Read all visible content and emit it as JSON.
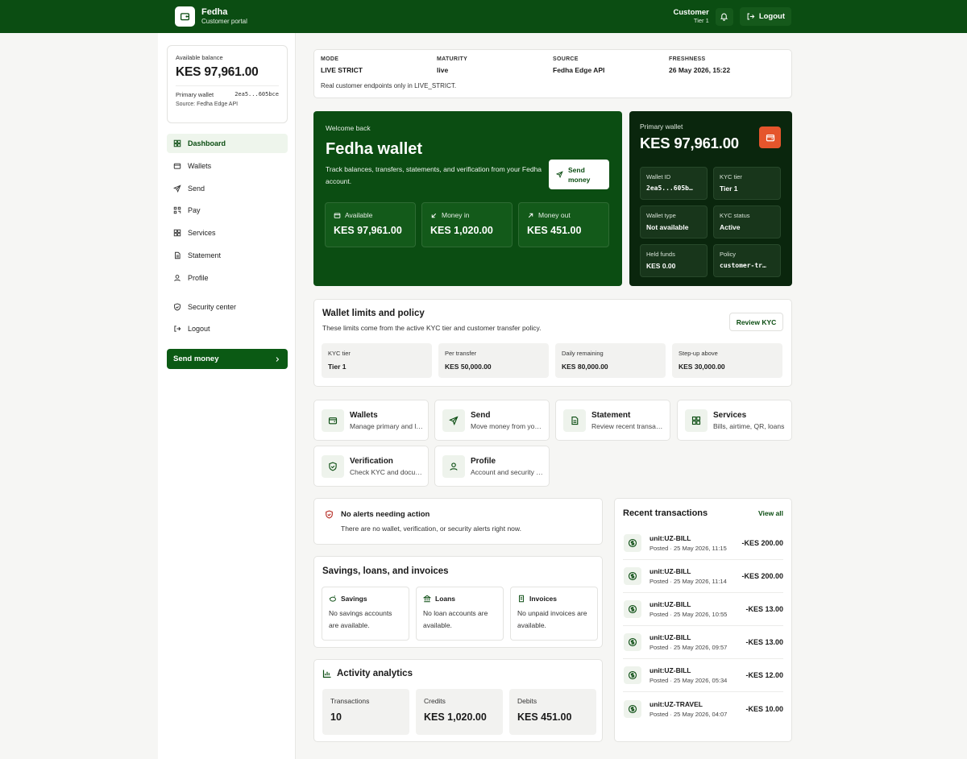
{
  "brand": {
    "title": "Fedha",
    "subtitle": "Customer portal"
  },
  "user": {
    "name": "Customer",
    "tier": "Tier 1"
  },
  "topbar": {
    "logout_label": "Logout"
  },
  "sidebar": {
    "balance_label": "Available balance",
    "balance_amount": "KES 97,961.00",
    "wallet_label": "Primary wallet",
    "wallet_id": "2ea5...605bce",
    "source": "Source: Fedha Edge API",
    "items": [
      {
        "label": "Dashboard",
        "icon": "dashboard-icon"
      },
      {
        "label": "Wallets",
        "icon": "wallet-icon"
      },
      {
        "label": "Send",
        "icon": "send-icon"
      },
      {
        "label": "Pay",
        "icon": "qr-icon"
      },
      {
        "label": "Services",
        "icon": "grid-icon"
      },
      {
        "label": "Statement",
        "icon": "document-icon"
      },
      {
        "label": "Profile",
        "icon": "user-icon"
      }
    ],
    "secondary": [
      {
        "label": "Security center",
        "icon": "shield-icon"
      },
      {
        "label": "Logout",
        "icon": "logout-icon"
      }
    ],
    "send_money_label": "Send money"
  },
  "mode": {
    "columns": [
      {
        "label": "MODE",
        "value": "LIVE STRICT"
      },
      {
        "label": "MATURITY",
        "value": "live"
      },
      {
        "label": "SOURCE",
        "value": "Fedha Edge API"
      },
      {
        "label": "FRESHNESS",
        "value": "26 May 2026, 15:22"
      }
    ],
    "note": "Real customer endpoints only in LIVE_STRICT."
  },
  "welcome": {
    "small": "Welcome back",
    "title": "Fedha wallet",
    "description": "Track balances, transfers, statements, and verification from your Fedha account.",
    "send_label_1": "Send",
    "send_label_2": "money",
    "stats": [
      {
        "label": "Available",
        "value": "KES 97,961.00"
      },
      {
        "label": "Money in",
        "value": "KES 1,020.00"
      },
      {
        "label": "Money out",
        "value": "KES 451.00"
      }
    ]
  },
  "primary_wallet": {
    "label": "Primary wallet",
    "amount": "KES 97,961.00",
    "cells": [
      {
        "label": "Wallet ID",
        "value": "2ea5...605b…",
        "mono": true
      },
      {
        "label": "KYC tier",
        "value": "Tier 1",
        "mono": false
      },
      {
        "label": "Wallet type",
        "value": "Not available",
        "mono": false
      },
      {
        "label": "KYC status",
        "value": "Active",
        "mono": false
      },
      {
        "label": "Held funds",
        "value": "KES 0.00",
        "mono": false
      },
      {
        "label": "Policy",
        "value": "customer-tr…",
        "mono": true
      }
    ]
  },
  "limits": {
    "title": "Wallet limits and policy",
    "subtitle": "These limits come from the active KYC tier and customer transfer policy.",
    "review_label": "Review KYC",
    "cells": [
      {
        "label": "KYC tier",
        "value": "Tier 1"
      },
      {
        "label": "Per transfer",
        "value": "KES 50,000.00"
      },
      {
        "label": "Daily remaining",
        "value": "KES 80,000.00"
      },
      {
        "label": "Step-up above",
        "value": "KES 30,000.00"
      }
    ]
  },
  "tiles": [
    {
      "title": "Wallets",
      "sub": "Manage primary and linked wallets"
    },
    {
      "title": "Send",
      "sub": "Move money from your wallet"
    },
    {
      "title": "Statement",
      "sub": "Review recent transactions"
    },
    {
      "title": "Services",
      "sub": "Bills, airtime, QR, loans"
    },
    {
      "title": "Verification",
      "sub": "Check KYC and documents"
    },
    {
      "title": "Profile",
      "sub": "Account and security settings"
    }
  ],
  "alerts": {
    "title": "No alerts needing action",
    "subtitle": "There are no wallet, verification, or security alerts right now."
  },
  "savings": {
    "title": "Savings, loans, and invoices",
    "cells": [
      {
        "title": "Savings",
        "body": "No savings accounts are available."
      },
      {
        "title": "Loans",
        "body": "No loan accounts are available."
      },
      {
        "title": "Invoices",
        "body": "No unpaid invoices are available."
      }
    ]
  },
  "analytics": {
    "title": "Activity analytics",
    "cells": [
      {
        "label": "Transactions",
        "value": "10"
      },
      {
        "label": "Credits",
        "value": "KES 1,020.00"
      },
      {
        "label": "Debits",
        "value": "KES 451.00"
      }
    ]
  },
  "recent": {
    "title": "Recent transactions",
    "view_all": "View all",
    "items": [
      {
        "name": "unit:UZ-BILL",
        "meta": "Posted · 25 May 2026, 11:15",
        "amount": "-KES 200.00"
      },
      {
        "name": "unit:UZ-BILL",
        "meta": "Posted · 25 May 2026, 11:14",
        "amount": "-KES 200.00"
      },
      {
        "name": "unit:UZ-BILL",
        "meta": "Posted · 25 May 2026, 10:55",
        "amount": "-KES 13.00"
      },
      {
        "name": "unit:UZ-BILL",
        "meta": "Posted · 25 May 2026, 09:57",
        "amount": "-KES 13.00"
      },
      {
        "name": "unit:UZ-BILL",
        "meta": "Posted · 25 May 2026, 05:34",
        "amount": "-KES 12.00"
      },
      {
        "name": "unit:UZ-TRAVEL",
        "meta": "Posted · 25 May 2026, 04:07",
        "amount": "-KES 10.00"
      }
    ]
  },
  "colors": {
    "brand": "#0b4d12",
    "wallet_card": "#0a260d",
    "accent": "#e5552c"
  }
}
